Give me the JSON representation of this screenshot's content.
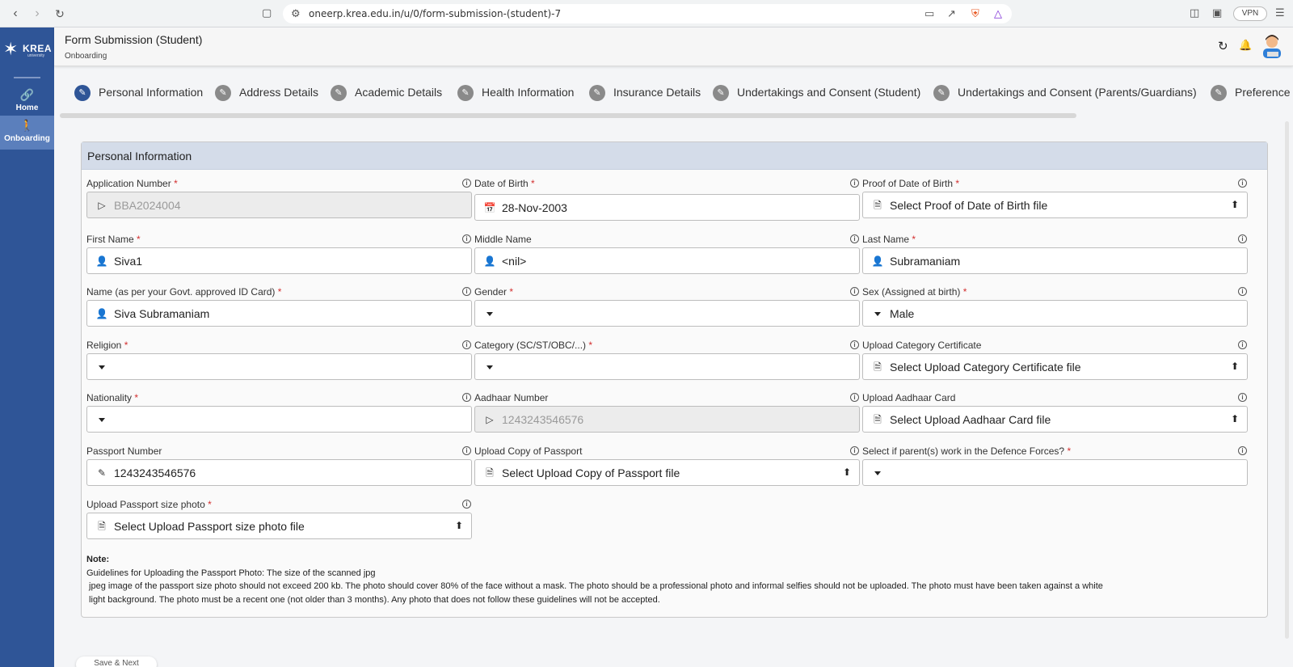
{
  "browser": {
    "url": "oneerp.krea.edu.in/u/0/form-submission-(student)-7",
    "vpn_label": "VPN",
    "shield_badge": "1"
  },
  "sidebar": {
    "logo_text": "KREA",
    "logo_sub": "university",
    "items": [
      {
        "label": "Home",
        "icon": "link-icon"
      },
      {
        "label": "Onboarding",
        "icon": "person-walking-icon"
      }
    ]
  },
  "header": {
    "title": "Form Submission (Student)",
    "subtitle": "Onboarding"
  },
  "steps": [
    {
      "label": "Personal Information"
    },
    {
      "label": "Address Details"
    },
    {
      "label": "Academic Details"
    },
    {
      "label": "Health Information"
    },
    {
      "label": "Insurance Details"
    },
    {
      "label": "Undertakings and Consent (Student)"
    },
    {
      "label": "Undertakings and Consent (Parents/Guardians)"
    },
    {
      "label": "Preference"
    }
  ],
  "section": {
    "title": "Personal Information"
  },
  "fields": {
    "application_number": {
      "label": "Application Number",
      "value": "BBA2024004"
    },
    "date_of_birth": {
      "label": "Date of Birth",
      "value": "28-Nov-2003"
    },
    "proof_dob": {
      "label": "Proof of Date of Birth",
      "value": "Select Proof of Date of Birth file"
    },
    "first_name": {
      "label": "First Name",
      "value": "Siva1"
    },
    "middle_name": {
      "label": "Middle Name",
      "value": "<nil>"
    },
    "last_name": {
      "label": "Last Name",
      "value": "Subramaniam"
    },
    "id_name": {
      "label": "Name (as per your Govt. approved ID Card)",
      "value": "Siva Subramaniam"
    },
    "gender": {
      "label": "Gender",
      "value": ""
    },
    "sex": {
      "label": "Sex (Assigned at birth)",
      "value": "Male"
    },
    "religion": {
      "label": "Religion",
      "value": ""
    },
    "category": {
      "label": "Category (SC/ST/OBC/...)",
      "value": ""
    },
    "category_cert": {
      "label": "Upload Category Certificate",
      "value": "Select Upload Category Certificate file"
    },
    "nationality": {
      "label": "Nationality",
      "value": ""
    },
    "aadhaar_number": {
      "label": "Aadhaar Number",
      "value": "1243243546576"
    },
    "aadhaar_card": {
      "label": "Upload Aadhaar Card",
      "value": "Select Upload Aadhaar Card file"
    },
    "passport_number": {
      "label": "Passport Number",
      "value": "1243243546576"
    },
    "passport_copy": {
      "label": "Upload Copy of Passport",
      "value": "Select Upload Copy of Passport file"
    },
    "defence": {
      "label": "Select if parent(s) work in the Defence Forces?",
      "value": ""
    },
    "passport_photo": {
      "label": "Upload Passport size photo",
      "value": "Select Upload Passport size photo file"
    }
  },
  "required_mark": "*",
  "note": {
    "heading": "Note:",
    "line1": "Guidelines for Uploading the Passport Photo: The size of the scanned jpg",
    "line2": " jpeg image of the passport size photo should not exceed 200 kb. The photo should cover 80% of the face without a mask. The photo should be a professional photo and informal selfies should not be uploaded. The photo must have been taken against a white",
    "line3": " light background. The photo must be a recent one (not older than 3 months). Any photo that does not follow these guidelines will not be accepted."
  },
  "footer": {
    "save_next_label": "Save & Next"
  }
}
